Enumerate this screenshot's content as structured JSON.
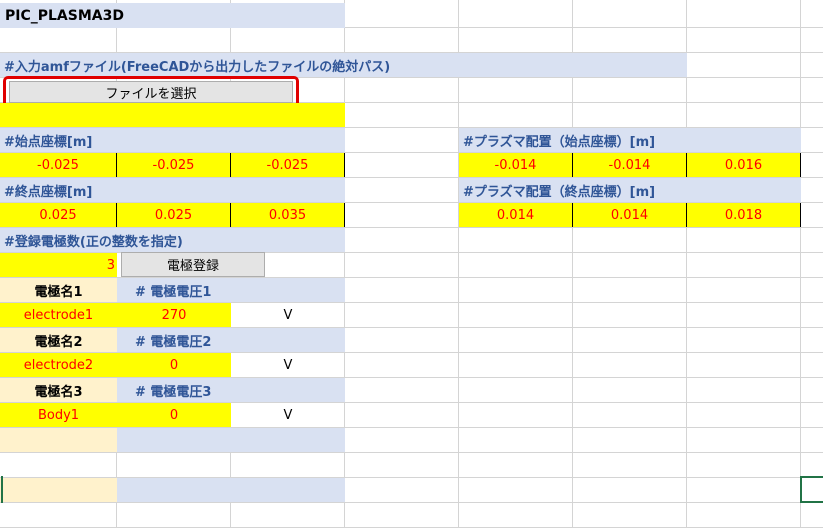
{
  "sheet": {
    "title": "PIC_PLASMA3D",
    "amf_header": "#入力amfファイル(FreeCADから出力したファイルの絶対パス)",
    "select_file_button": "ファイルを選択",
    "start_header": "#始点座標[m]",
    "start_values": [
      "-0.025",
      "-0.025",
      "-0.025"
    ],
    "end_header": "#終点座標[m]",
    "end_values": [
      "0.025",
      "0.025",
      "0.035"
    ],
    "plasma_start_header": "#プラズマ配置（始点座標）[m]",
    "plasma_start_values": [
      "-0.014",
      "-0.014",
      "0.016"
    ],
    "plasma_end_header": "#プラズマ配置（終点座標）[m]",
    "plasma_end_values": [
      "0.014",
      "0.014",
      "0.018"
    ],
    "electrode_count_header": "#登録電極数(正の整数を指定)",
    "electrode_count": "3",
    "register_button": "電極登録",
    "electrodes": [
      {
        "name_label": "電極名1",
        "voltage_label": "# 電極電圧1",
        "name": "electrode1",
        "voltage": "270",
        "unit": "V"
      },
      {
        "name_label": "電極名2",
        "voltage_label": "# 電極電圧2",
        "name": "electrode2",
        "voltage": "0",
        "unit": "V"
      },
      {
        "name_label": "電極名3",
        "voltage_label": "# 電極電圧3",
        "name": "Body1",
        "voltage": "0",
        "unit": "V"
      }
    ]
  },
  "colors": {
    "header_fill": "#d9e1f2",
    "value_fill": "#ffff00",
    "label_fill": "#fff2cc",
    "header_text": "#2f5597",
    "value_text": "#ff0000",
    "highlight": "#e00000"
  }
}
